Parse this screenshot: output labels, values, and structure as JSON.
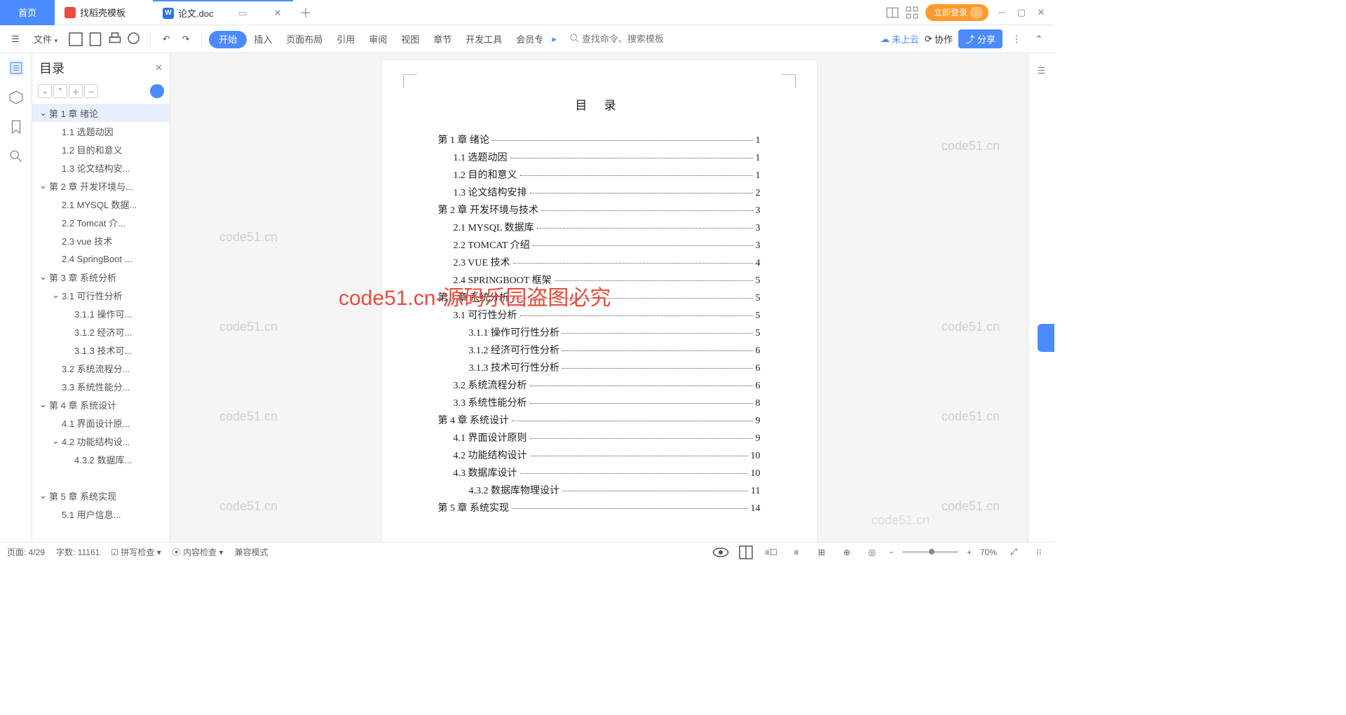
{
  "titlebar": {
    "home": "首页",
    "template_tab": "找稻壳模板",
    "doc_tab": "论文.doc",
    "login_btn": "立即登录"
  },
  "toolbar": {
    "file": "文件",
    "menus": [
      "开始",
      "插入",
      "页面布局",
      "引用",
      "审阅",
      "视图",
      "章节",
      "开发工具",
      "会员专"
    ],
    "search_placeholder": "查找命令、搜索模板",
    "cloud": "未上云",
    "collab": "协作",
    "share": "分享"
  },
  "sidebar": {
    "title": "目录",
    "items": [
      {
        "txt": "第 1 章 绪论",
        "lvl": 0,
        "chev": true,
        "active": true
      },
      {
        "txt": "1.1 选题动因",
        "lvl": 1
      },
      {
        "txt": "1.2 目的和意义",
        "lvl": 1
      },
      {
        "txt": "1.3 论文结构安...",
        "lvl": 1
      },
      {
        "txt": "第 2 章 开发环境与...",
        "lvl": 0,
        "chev": true
      },
      {
        "txt": "2.1 MYSQL 数据...",
        "lvl": 1
      },
      {
        "txt": "2.2 Tomcat 介...",
        "lvl": 1
      },
      {
        "txt": "2.3 vue 技术",
        "lvl": 1
      },
      {
        "txt": "2.4 SpringBoot ...",
        "lvl": 1
      },
      {
        "txt": "第 3 章 系统分析",
        "lvl": 0,
        "chev": true
      },
      {
        "txt": "3.1 可行性分析",
        "lvl": 1,
        "chev": true
      },
      {
        "txt": "3.1.1 操作可...",
        "lvl": 2
      },
      {
        "txt": "3.1.2 经济可...",
        "lvl": 2
      },
      {
        "txt": "3.1.3 技术可...",
        "lvl": 2
      },
      {
        "txt": "3.2 系统流程分...",
        "lvl": 1
      },
      {
        "txt": "3.3 系统性能分...",
        "lvl": 1
      },
      {
        "txt": "第 4 章 系统设计",
        "lvl": 0,
        "chev": true
      },
      {
        "txt": "4.1 界面设计原...",
        "lvl": 1
      },
      {
        "txt": "4.2 功能结构设...",
        "lvl": 1,
        "chev": true
      },
      {
        "txt": "4.3.2 数据库...",
        "lvl": 2
      },
      {
        "txt": "",
        "lvl": 0,
        "blank": true
      },
      {
        "txt": "第 5 章 系统实现",
        "lvl": 0,
        "chev": true
      },
      {
        "txt": "5.1 用户信息...",
        "lvl": 1
      }
    ]
  },
  "doc": {
    "title": "目 录",
    "toc": [
      {
        "t": "第 1 章 绪论",
        "p": "1",
        "i": 0
      },
      {
        "t": "1.1 选题动因",
        "p": "1",
        "i": 1
      },
      {
        "t": "1.2 目的和意义",
        "p": "1",
        "i": 1
      },
      {
        "t": "1.3 论文结构安排",
        "p": "2",
        "i": 1
      },
      {
        "t": "第 2 章 开发环境与技术",
        "p": "3",
        "i": 0
      },
      {
        "t": "2.1 MYSQL 数据库",
        "p": "3",
        "i": 1
      },
      {
        "t": "2.2 TOMCAT 介绍",
        "p": "3",
        "i": 1
      },
      {
        "t": "2.3 VUE 技术",
        "p": "4",
        "i": 1
      },
      {
        "t": "2.4 SPRINGBOOT 框架",
        "p": "5",
        "i": 1
      },
      {
        "t": "第 3 章 系统分析",
        "p": "5",
        "i": 0
      },
      {
        "t": "3.1 可行性分析",
        "p": "5",
        "i": 1
      },
      {
        "t": "3.1.1 操作可行性分析",
        "p": "5",
        "i": 2
      },
      {
        "t": "3.1.2 经济可行性分析",
        "p": "6",
        "i": 2
      },
      {
        "t": "3.1.3 技术可行性分析",
        "p": "6",
        "i": 2
      },
      {
        "t": "3.2 系统流程分析",
        "p": "6",
        "i": 1
      },
      {
        "t": "3.3 系统性能分析",
        "p": "8",
        "i": 1
      },
      {
        "t": "第 4 章 系统设计",
        "p": "9",
        "i": 0
      },
      {
        "t": "4.1 界面设计原则",
        "p": "9",
        "i": 1
      },
      {
        "t": "4.2 功能结构设计",
        "p": "10",
        "i": 1
      },
      {
        "t": "4.3 数据库设计",
        "p": "10",
        "i": 1
      },
      {
        "t": "4.3.2 数据库物理设计",
        "p": "11",
        "i": 2
      },
      {
        "t": "第 5 章 系统实现",
        "p": "14",
        "i": 0
      }
    ]
  },
  "status": {
    "page": "页面: 4/29",
    "words": "字数: 11161",
    "spell": "拼写检查",
    "content": "内容检查",
    "compat": "兼容模式",
    "zoom": "70%"
  },
  "wm": {
    "small": "code51.cn",
    "big": "code51.cn-源码乐园盗图必究"
  }
}
